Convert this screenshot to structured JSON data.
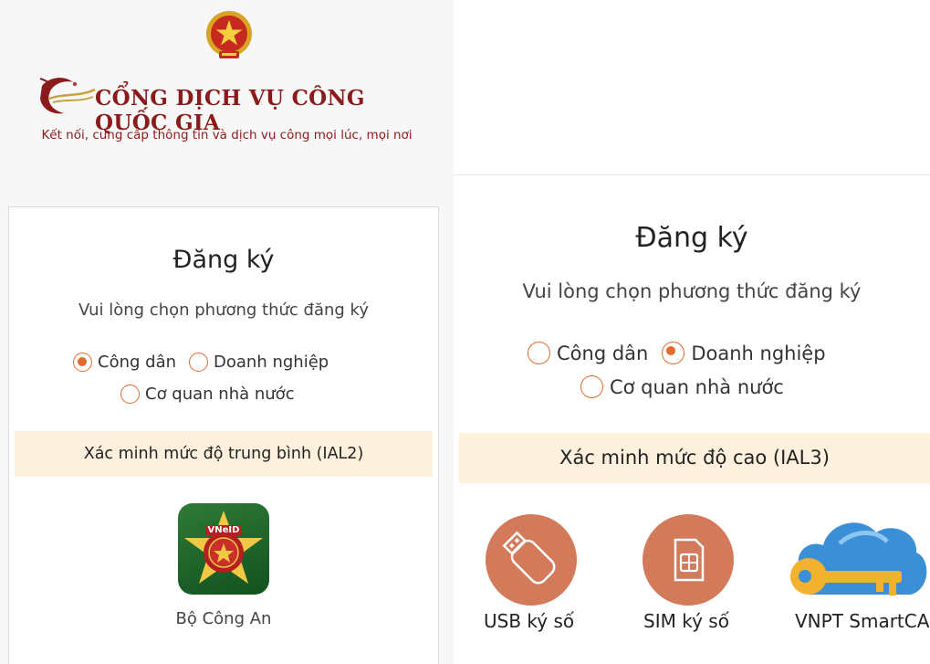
{
  "portal": {
    "brand_title": "CỔNG DỊCH VỤ CÔNG QUỐC GIA",
    "tagline": "Kết nối, cung cấp thông tin và dịch vụ công mọi lúc, mọi nơi",
    "brand_color": "#8b1b1b"
  },
  "left_panel": {
    "title": "Đăng ký",
    "subtitle": "Vui lòng chọn phương thức đăng ký",
    "account_types": [
      {
        "label": "Công dân",
        "selected": true
      },
      {
        "label": "Doanh nghiệp",
        "selected": false
      },
      {
        "label": "Cơ quan nhà nước",
        "selected": false
      }
    ],
    "verification_level": "Xác minh mức độ trung bình (IAL2)",
    "providers": [
      {
        "label": "Bộ Công An",
        "icon": "vneid-app-icon",
        "badge_text": "VNeID"
      }
    ]
  },
  "right_panel": {
    "title": "Đăng ký",
    "subtitle": "Vui lòng chọn phương thức đăng ký",
    "account_types": [
      {
        "label": "Công dân",
        "selected": false
      },
      {
        "label": "Doanh nghiệp",
        "selected": true
      },
      {
        "label": "Cơ quan nhà nước",
        "selected": false
      }
    ],
    "verification_level": "Xác minh mức độ cao (IAL3)",
    "providers": [
      {
        "label": "USB ký số",
        "icon": "usb-token-icon"
      },
      {
        "label": "SIM ký số",
        "icon": "sim-card-icon"
      },
      {
        "label": "VNPT SmartCA",
        "icon": "cloud-key-icon"
      }
    ]
  },
  "colors": {
    "accent_radio": "#e06b2c",
    "ial_band": "#fdf1de",
    "provider_circle": "#d37a5b",
    "vneid_green": "#2f7a36"
  }
}
